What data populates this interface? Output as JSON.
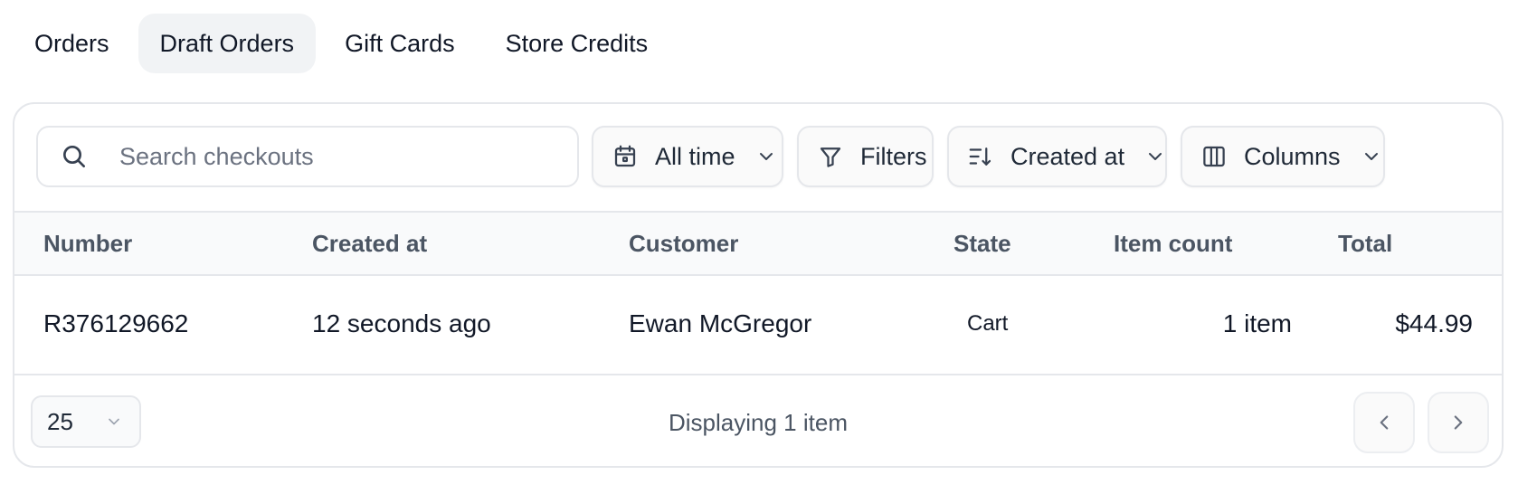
{
  "tabs": [
    {
      "label": "Orders",
      "active": false
    },
    {
      "label": "Draft Orders",
      "active": true
    },
    {
      "label": "Gift Cards",
      "active": false
    },
    {
      "label": "Store Credits",
      "active": false
    }
  ],
  "toolbar": {
    "search_placeholder": "Search checkouts",
    "search_icon": "search-icon",
    "date_filter_label": "All time",
    "date_filter_icon": "calendar-icon",
    "filters_label": "Filters",
    "filters_icon": "filter-icon",
    "sort_label": "Created at",
    "sort_icon": "sort-descending-icon",
    "columns_label": "Columns",
    "columns_icon": "columns-icon"
  },
  "table": {
    "columns": [
      "Number",
      "Created at",
      "Customer",
      "State",
      "Item count",
      "Total"
    ],
    "rows": [
      {
        "number": "R376129662",
        "created_at": "12 seconds ago",
        "customer": "Ewan McGregor",
        "state": "Cart",
        "item_count": "1 item",
        "total": "$44.99"
      }
    ]
  },
  "footer": {
    "per_page": "25",
    "display_text": "Displaying 1 item",
    "prev_icon": "chevron-left-icon",
    "next_icon": "chevron-right-icon"
  },
  "colors": {
    "border": "#e5e7eb",
    "active_tab_bg": "#f1f3f5",
    "header_bg": "#f9fafb",
    "muted_text": "#4b5563",
    "text": "#111827"
  }
}
